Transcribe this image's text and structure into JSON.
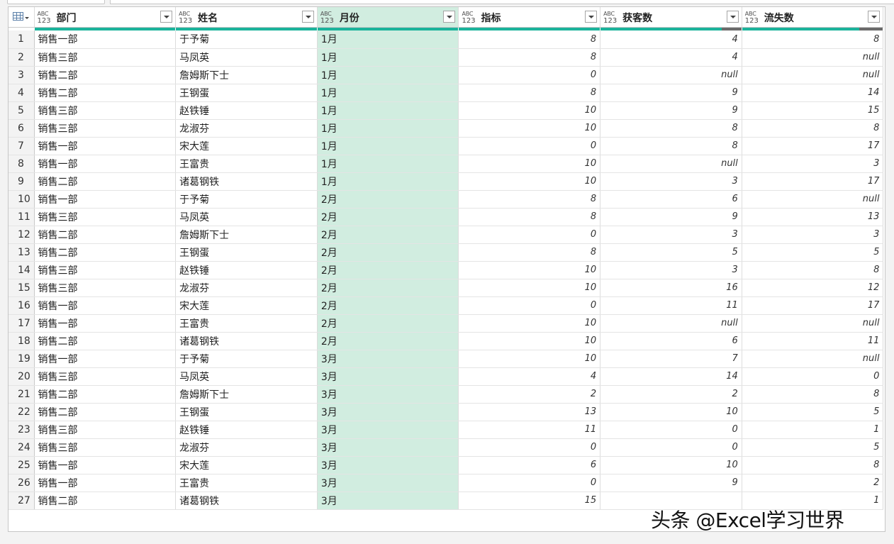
{
  "columns": [
    {
      "name": "部门",
      "type_top": "ABC",
      "type_bottom": "123"
    },
    {
      "name": "姓名",
      "type_top": "ABC",
      "type_bottom": "123"
    },
    {
      "name": "月份",
      "type_top": "ABC",
      "type_bottom": "123"
    },
    {
      "name": "指标",
      "type_top": "ABC",
      "type_bottom": "123"
    },
    {
      "name": "获客数",
      "type_top": "ABC",
      "type_bottom": "123"
    },
    {
      "name": "流失数",
      "type_top": "ABC",
      "type_bottom": "123"
    }
  ],
  "selected_column": "月份",
  "accent_color": "#1bb39b",
  "selected_fill": "#d1ede0",
  "column_quality": [
    {
      "valid": 1.0,
      "error": 0.0
    },
    {
      "valid": 1.0,
      "error": 0.0
    },
    {
      "valid": 1.0,
      "error": 0.0
    },
    {
      "valid": 1.0,
      "error": 0.0
    },
    {
      "valid": 0.86,
      "error": 0.14
    },
    {
      "valid": 0.83,
      "error": 0.17
    }
  ],
  "rows": [
    [
      "1",
      "销售一部",
      "于予菊",
      "1月",
      "8",
      "4",
      "8"
    ],
    [
      "2",
      "销售三部",
      "马凤英",
      "1月",
      "8",
      "4",
      "null"
    ],
    [
      "3",
      "销售二部",
      "詹姆斯下士",
      "1月",
      "0",
      "null",
      "null"
    ],
    [
      "4",
      "销售二部",
      "王钢蛋",
      "1月",
      "8",
      "9",
      "14"
    ],
    [
      "5",
      "销售三部",
      "赵铁锤",
      "1月",
      "10",
      "9",
      "15"
    ],
    [
      "6",
      "销售三部",
      "龙淑芬",
      "1月",
      "10",
      "8",
      "8"
    ],
    [
      "7",
      "销售一部",
      "宋大莲",
      "1月",
      "0",
      "8",
      "17"
    ],
    [
      "8",
      "销售一部",
      "王富贵",
      "1月",
      "10",
      "null",
      "3"
    ],
    [
      "9",
      "销售二部",
      "诸葛钢铁",
      "1月",
      "10",
      "3",
      "17"
    ],
    [
      "10",
      "销售一部",
      "于予菊",
      "2月",
      "8",
      "6",
      "null"
    ],
    [
      "11",
      "销售三部",
      "马凤英",
      "2月",
      "8",
      "9",
      "13"
    ],
    [
      "12",
      "销售二部",
      "詹姆斯下士",
      "2月",
      "0",
      "3",
      "3"
    ],
    [
      "13",
      "销售二部",
      "王钢蛋",
      "2月",
      "8",
      "5",
      "5"
    ],
    [
      "14",
      "销售三部",
      "赵铁锤",
      "2月",
      "10",
      "3",
      "8"
    ],
    [
      "15",
      "销售三部",
      "龙淑芬",
      "2月",
      "10",
      "16",
      "12"
    ],
    [
      "16",
      "销售一部",
      "宋大莲",
      "2月",
      "0",
      "11",
      "17"
    ],
    [
      "17",
      "销售一部",
      "王富贵",
      "2月",
      "10",
      "null",
      "null"
    ],
    [
      "18",
      "销售二部",
      "诸葛钢铁",
      "2月",
      "10",
      "6",
      "11"
    ],
    [
      "19",
      "销售一部",
      "于予菊",
      "3月",
      "10",
      "7",
      "null"
    ],
    [
      "20",
      "销售三部",
      "马凤英",
      "3月",
      "4",
      "14",
      "0"
    ],
    [
      "21",
      "销售二部",
      "詹姆斯下士",
      "3月",
      "2",
      "2",
      "8"
    ],
    [
      "22",
      "销售二部",
      "王钢蛋",
      "3月",
      "13",
      "10",
      "5"
    ],
    [
      "23",
      "销售三部",
      "赵铁锤",
      "3月",
      "11",
      "0",
      "1"
    ],
    [
      "24",
      "销售三部",
      "龙淑芬",
      "3月",
      "0",
      "0",
      "5"
    ],
    [
      "25",
      "销售一部",
      "宋大莲",
      "3月",
      "6",
      "10",
      "8"
    ],
    [
      "26",
      "销售一部",
      "王富贵",
      "3月",
      "0",
      "9",
      "2"
    ],
    [
      "27",
      "销售二部",
      "诸葛钢铁",
      "3月",
      "15",
      "",
      "1"
    ]
  ],
  "watermark": "头条 @Excel学习世界"
}
